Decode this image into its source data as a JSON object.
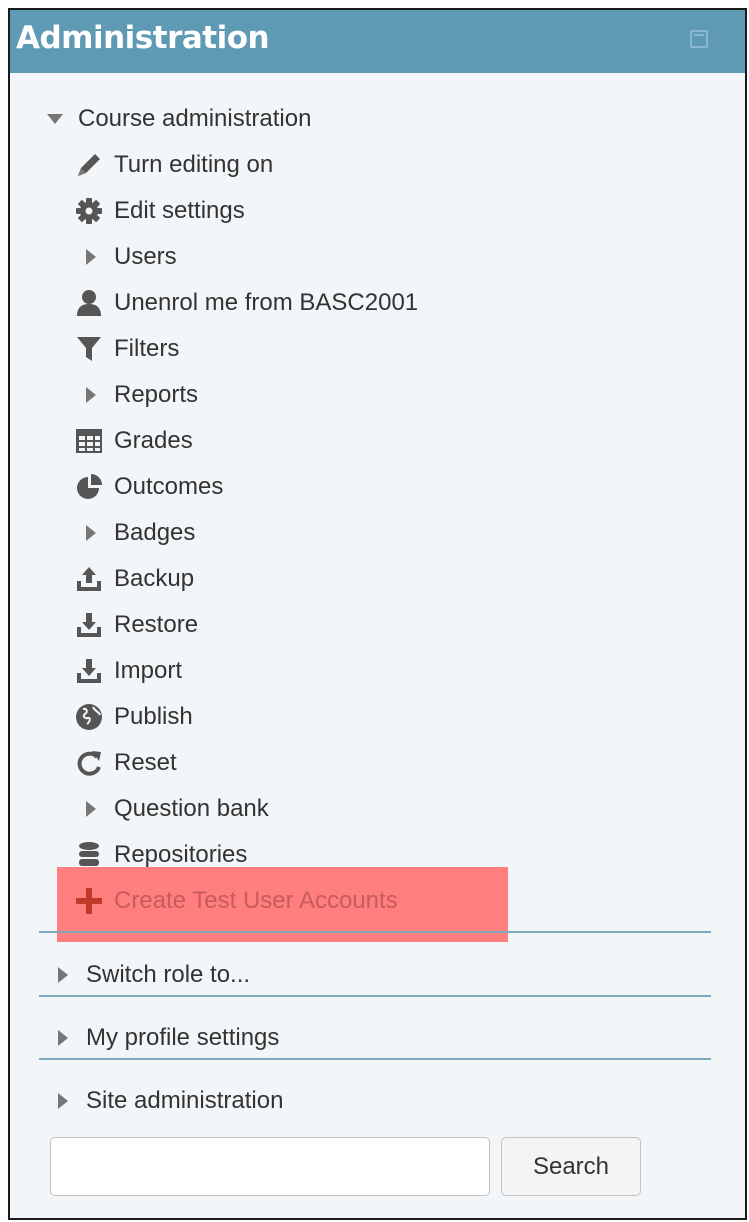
{
  "block": {
    "title": "Administration"
  },
  "course_admin": {
    "label": "Course administration",
    "items": [
      {
        "label": "Turn editing on",
        "icon": "pencil-icon"
      },
      {
        "label": "Edit settings",
        "icon": "gear-icon"
      },
      {
        "label": "Users",
        "icon": "caret-right-icon"
      },
      {
        "label": "Unenrol me from BASC2001",
        "icon": "user-icon"
      },
      {
        "label": "Filters",
        "icon": "filter-icon"
      },
      {
        "label": "Reports",
        "icon": "caret-right-icon"
      },
      {
        "label": "Grades",
        "icon": "table-icon"
      },
      {
        "label": "Outcomes",
        "icon": "outcomes-icon"
      },
      {
        "label": "Badges",
        "icon": "caret-right-icon"
      },
      {
        "label": "Backup",
        "icon": "upload-icon"
      },
      {
        "label": "Restore",
        "icon": "download-icon"
      },
      {
        "label": "Import",
        "icon": "download-icon"
      },
      {
        "label": "Publish",
        "icon": "globe-icon"
      },
      {
        "label": "Reset",
        "icon": "refresh-icon"
      },
      {
        "label": "Question bank",
        "icon": "caret-right-icon"
      },
      {
        "label": "Repositories",
        "icon": "database-icon"
      },
      {
        "label": "Create Test User Accounts",
        "icon": "plus-icon"
      }
    ]
  },
  "sections": [
    {
      "label": "Switch role to..."
    },
    {
      "label": "My profile settings"
    },
    {
      "label": "Site administration"
    }
  ],
  "search": {
    "placeholder": "",
    "button_label": "Search"
  },
  "colors": {
    "header": "#5f9ab5",
    "highlight": "#ff7f7f",
    "create_text": "#c85b5b",
    "icon": "#555555"
  }
}
